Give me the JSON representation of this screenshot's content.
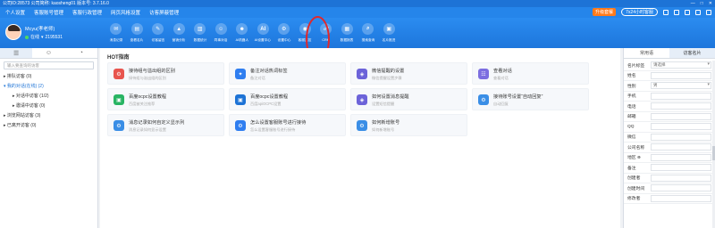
{
  "topbar": {
    "title": "公司ID:28573  公司简称: kaosheng01  版本号: 3.7.16.0"
  },
  "menu": {
    "items": [
      "个人设置",
      "客服账号管理",
      "客服行政管理",
      "网页风格设置",
      "访客屏蔽管理"
    ],
    "upgrade": "升级套餐",
    "online": "7x24小时客服"
  },
  "profile": {
    "name": "Mcyu(孝老师)",
    "status": "在线",
    "id": "2195531"
  },
  "toolbar": [
    {
      "label": "消息记录",
      "icon": "message-icon",
      "glyph": "✉"
    },
    {
      "label": "查看名片",
      "icon": "card-icon",
      "glyph": "▤"
    },
    {
      "label": "访客留言",
      "icon": "comment-icon",
      "glyph": "✎"
    },
    {
      "label": "营销分析",
      "icon": "chart-icon",
      "glyph": "▲"
    },
    {
      "label": "数据统计",
      "icon": "stats-icon",
      "glyph": "▥"
    },
    {
      "label": "同事对话",
      "icon": "colleague-icon",
      "glyph": "☺"
    },
    {
      "label": "AI机器人",
      "icon": "robot-icon",
      "glyph": "☻"
    },
    {
      "label": "AI设置中心",
      "icon": "ai-icon",
      "glyph": "AI"
    },
    {
      "label": "设置中心",
      "icon": "gear-icon",
      "glyph": "⚙"
    },
    {
      "label": "客服监控",
      "icon": "monitor-icon",
      "glyph": "◉"
    },
    {
      "label": "CRM",
      "icon": "crm-icon",
      "glyph": "☍"
    },
    {
      "label": "数据报表",
      "icon": "report-icon",
      "glyph": "▦"
    },
    {
      "label": "搜索查询",
      "icon": "search-icon",
      "glyph": "⌕"
    },
    {
      "label": "名片推进",
      "icon": "push-icon",
      "glyph": "▣"
    }
  ],
  "leftTabs": [
    "☰",
    "☺",
    "◔"
  ],
  "leftSearch": {
    "placeholder": "输入要查询的访客"
  },
  "tree": [
    {
      "label": "▸ 排队访客 (0)",
      "level": 1
    },
    {
      "label": "▾ 我的对话(在线) (2)",
      "level": 1,
      "selected": true
    },
    {
      "label": "▸ 对话中访客 (1/2)",
      "level": 2
    },
    {
      "label": "▸ 邀请中访客 (0)",
      "level": 2
    },
    {
      "label": "▸ 浏览网站访客 (3)",
      "level": 1
    },
    {
      "label": "▸ 已离开访客 (0)",
      "level": 1
    }
  ],
  "main": {
    "heading": "HOT指南",
    "cards": [
      {
        "title": "接待组与溢出组的区别",
        "sub": "接待组与溢出组的区别",
        "icon": "gear-icon",
        "color": "#e8554e",
        "glyph": "⚙"
      },
      {
        "title": "备注对话热词标签",
        "sub": "备注对话",
        "icon": "tag-icon",
        "color": "#2f7ef0",
        "glyph": "✦"
      },
      {
        "title": "微信提醒的设置",
        "sub": "微信提醒设置步骤",
        "icon": "wechat-icon",
        "color": "#6c63d9",
        "glyph": "◈"
      },
      {
        "title": "查看对话",
        "sub": "查看对话",
        "icon": "chat-icon",
        "color": "#7c6ee0",
        "glyph": "☷"
      },
      {
        "title": "百度ocpc设置教程",
        "sub": "百度被关注推荐",
        "icon": "baidu-icon",
        "color": "#28b463",
        "glyph": "▣"
      },
      {
        "title": "百度ocpc设置教程",
        "sub": "百度apiOCPC设置",
        "icon": "baidu-api-icon",
        "color": "#1d73d6",
        "glyph": "▣"
      },
      {
        "title": "如何设置消息提醒",
        "sub": "设置短信提醒",
        "icon": "bell-icon",
        "color": "#6c63d9",
        "glyph": "◈"
      },
      {
        "title": "接待账号设置“自动回复”",
        "sub": "自动回复",
        "icon": "reply-icon",
        "color": "#3a8ee6",
        "glyph": "⚙"
      },
      {
        "title": "消息记录如何自定义显示列",
        "sub": "消息记录如何显示设置",
        "icon": "list-icon",
        "color": "#3a8ee6",
        "glyph": "⚙"
      },
      {
        "title": "怎么设置客服账号进行接待",
        "sub": "怎么设置客服账号进行接待",
        "icon": "account-icon",
        "color": "#2f7ef0",
        "glyph": "⚙"
      },
      {
        "title": "如何新增账号",
        "sub": "如何新增账号",
        "icon": "add-user-icon",
        "color": "#3a8ee6",
        "glyph": "⚙"
      }
    ]
  },
  "rightTabs": [
    "常用语",
    "访客名片"
  ],
  "rightRows": [
    {
      "key": "名片标签",
      "value": "请选择",
      "select": true
    },
    {
      "key": "姓名",
      "value": ""
    },
    {
      "key": "性别",
      "value": "男",
      "select": true
    },
    {
      "key": "手机",
      "value": ""
    },
    {
      "key": "电话",
      "value": ""
    },
    {
      "key": "邮箱",
      "value": ""
    },
    {
      "key": "QQ",
      "value": ""
    },
    {
      "key": "微信",
      "value": ""
    },
    {
      "key": "公司名称",
      "value": ""
    },
    {
      "key": "地区 ⊕",
      "value": ""
    },
    {
      "key": "备注",
      "value": ""
    },
    {
      "key": "创建者",
      "value": ""
    },
    {
      "key": "创建时间",
      "value": ""
    },
    {
      "key": "修改者",
      "value": ""
    }
  ]
}
